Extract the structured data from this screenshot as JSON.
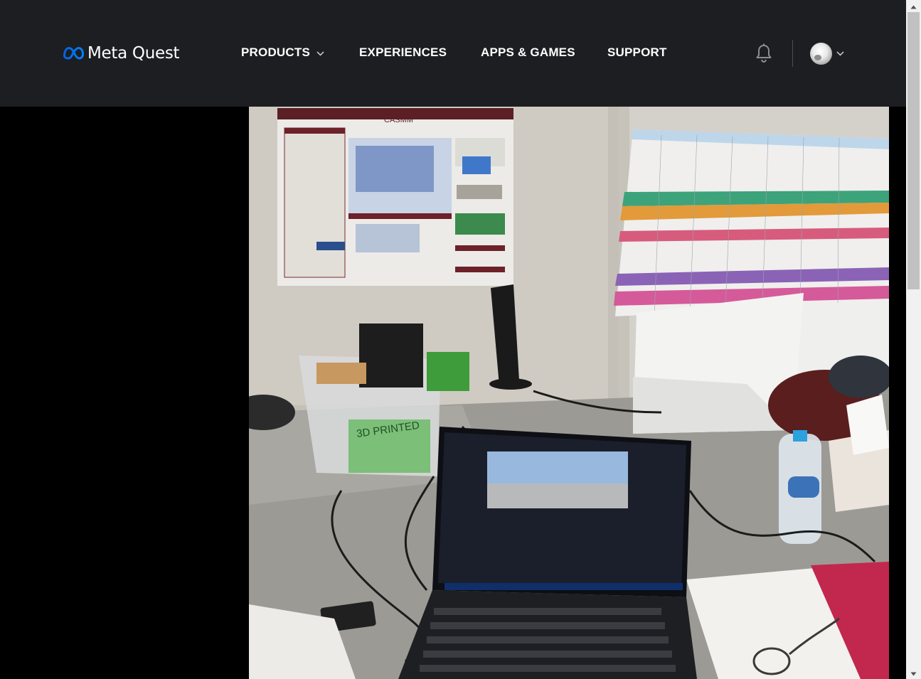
{
  "header": {
    "brand": "Meta Quest",
    "nav": {
      "products": "PRODUCTS",
      "experiences": "EXPERIENCES",
      "apps_games": "APPS & GAMES",
      "support": "SUPPORT"
    },
    "icons": {
      "logo": "meta-infinity-icon",
      "products_dropdown": "chevron-down-icon",
      "notifications": "bell-icon",
      "account_dropdown": "chevron-down-icon"
    }
  },
  "media": {
    "sign_text": "3D PRINTED",
    "poster_title": "CASMM"
  },
  "colors": {
    "header_bg": "#1c1e21",
    "page_bg": "#000000",
    "meta_blue": "#0082fb",
    "scrollbar_track": "#f1f1f1",
    "scrollbar_thumb": "#c1c1c1"
  }
}
